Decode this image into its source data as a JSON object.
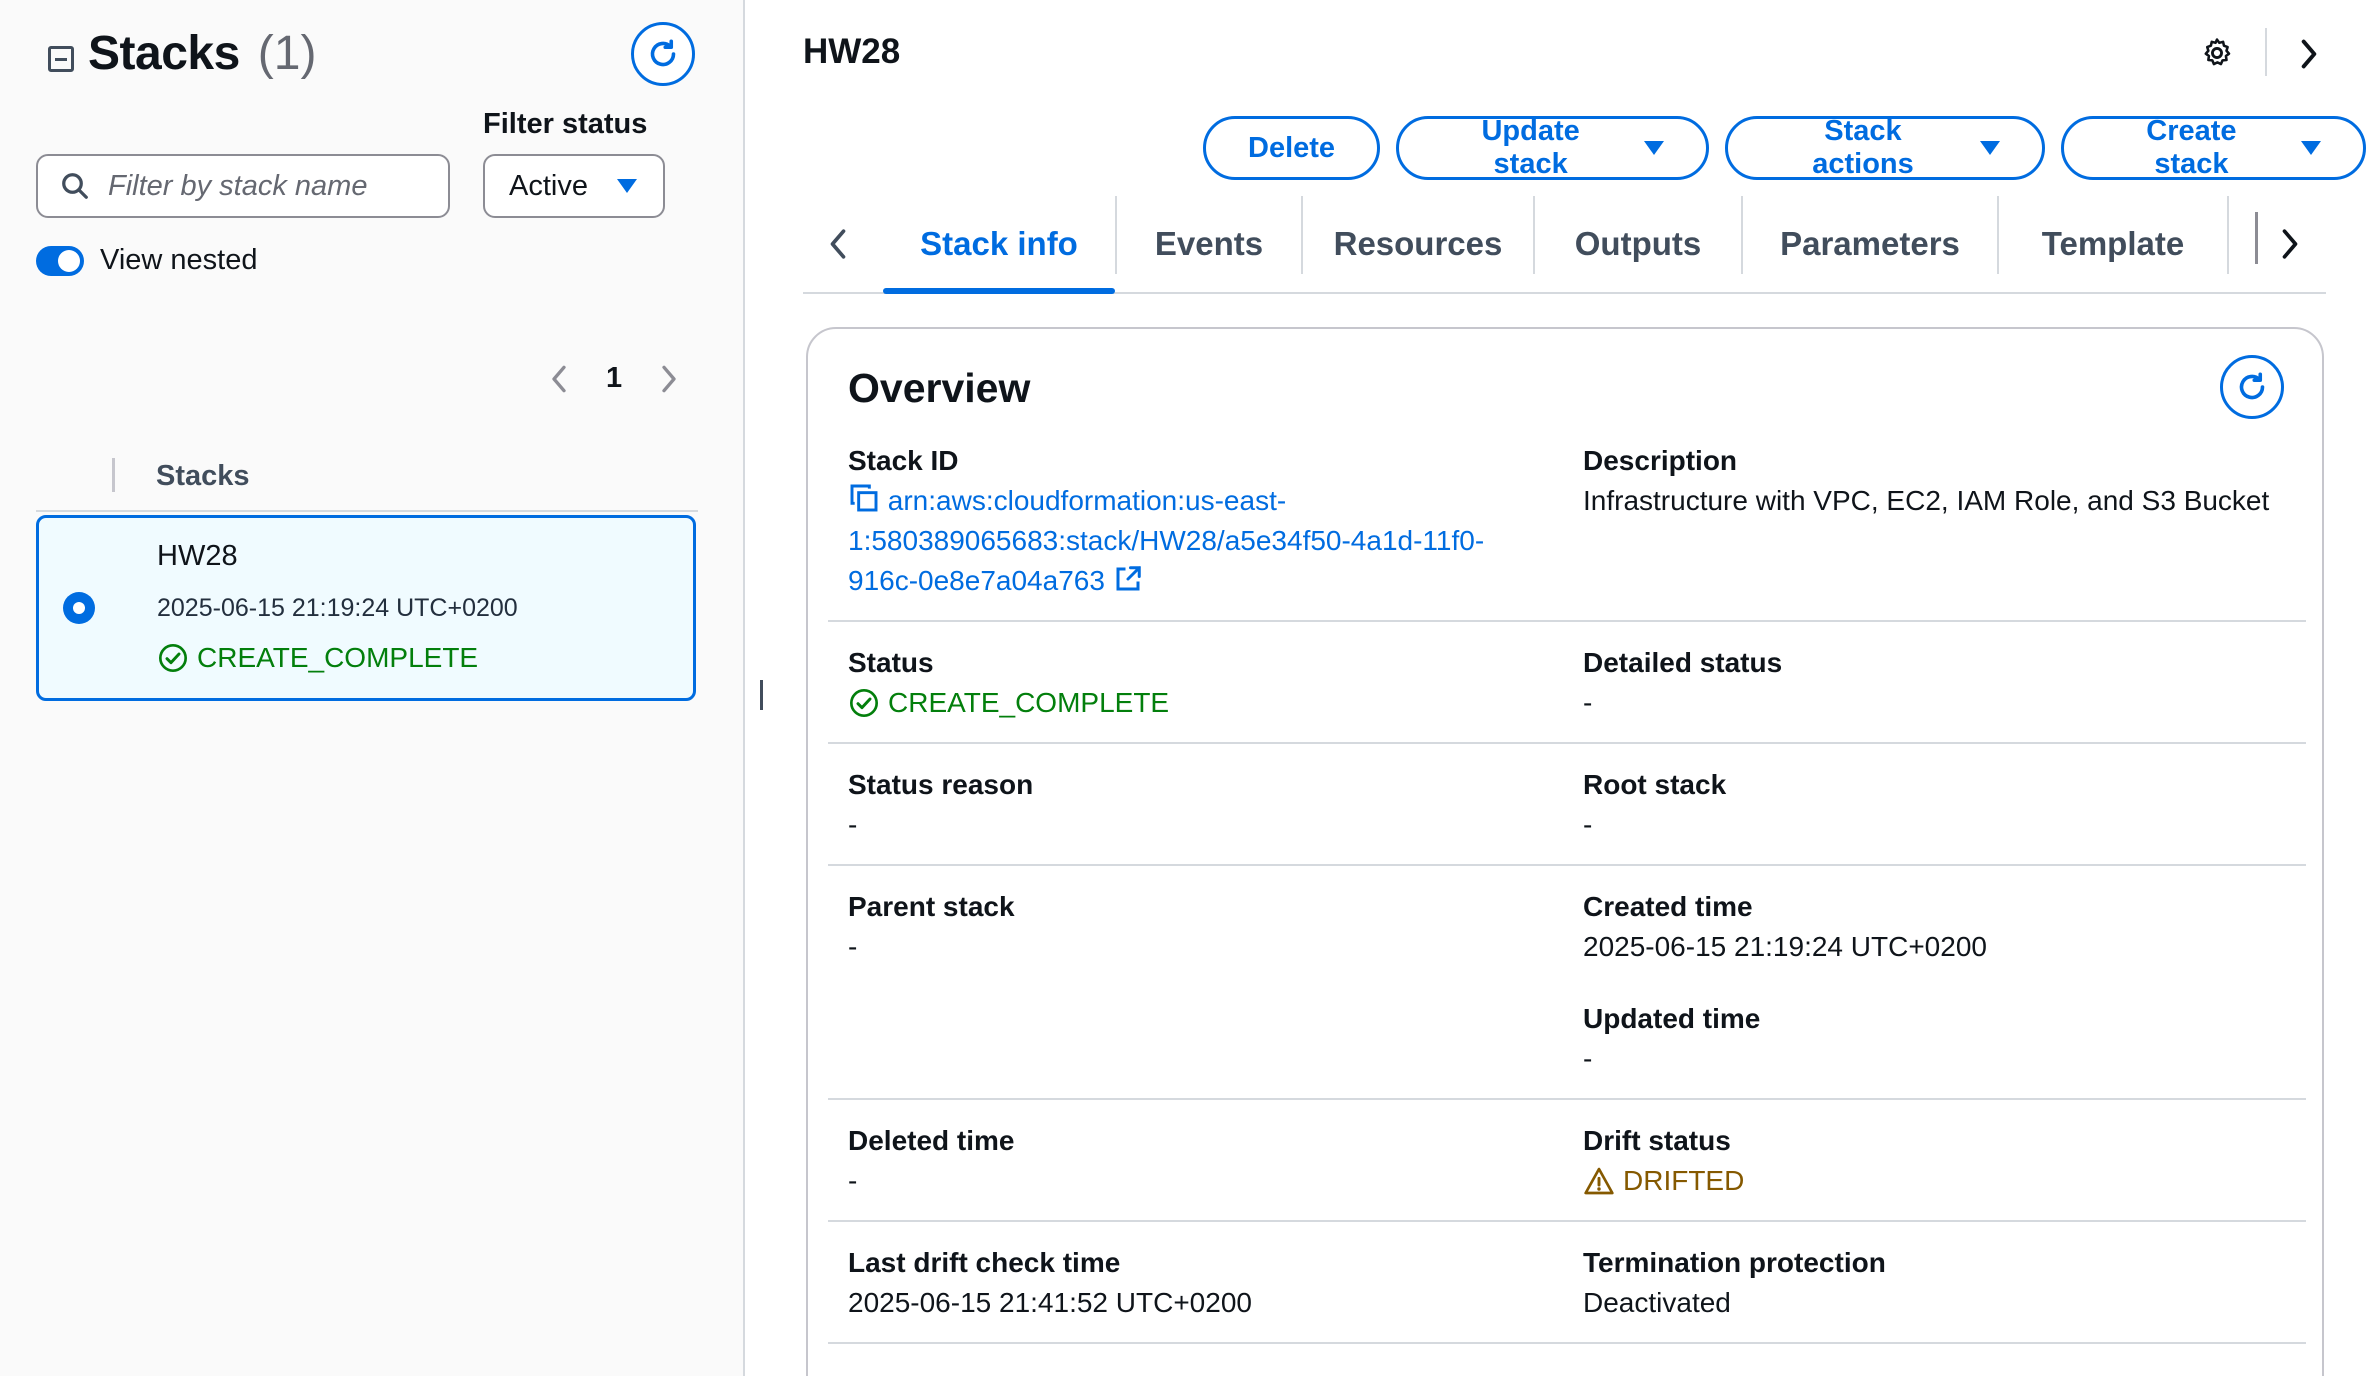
{
  "left_panel": {
    "title": "Stacks",
    "count": "(1)",
    "search_placeholder": "Filter by stack name",
    "filter_label": "Filter status",
    "filter_value": "Active",
    "view_nested_label": "View nested",
    "page_number": "1",
    "column_header": "Stacks",
    "stack": {
      "name": "HW28",
      "timestamp": "2025-06-15 21:19:24 UTC+0200",
      "status": "CREATE_COMPLETE"
    }
  },
  "header": {
    "stack_name": "HW28"
  },
  "actions": {
    "delete": "Delete",
    "update_stack": "Update stack",
    "stack_actions": "Stack actions",
    "create_stack": "Create stack"
  },
  "tabs": [
    "Stack info",
    "Events",
    "Resources",
    "Outputs",
    "Parameters",
    "Template"
  ],
  "overview": {
    "title": "Overview",
    "stack_id_label": "Stack ID",
    "stack_id": "arn:aws:cloudformation:us-east-1:580389065683:stack/HW28/a5e34f50-4a1d-11f0-916c-0e8e7a04a763",
    "stack_id_lines": [
      "arn:aws:cloudformation:us-east-",
      "1:580389065683:stack/HW28/a5e34f50-4a1d-11f0-",
      "916c-0e8e7a04a763"
    ],
    "description_label": "Description",
    "description": "Infrastructure with VPC, EC2, IAM Role, and S3 Bucket",
    "status_label": "Status",
    "status": "CREATE_COMPLETE",
    "detailed_status_label": "Detailed status",
    "detailed_status": "-",
    "status_reason_label": "Status reason",
    "status_reason": "-",
    "root_stack_label": "Root stack",
    "root_stack": "-",
    "parent_stack_label": "Parent stack",
    "parent_stack": "-",
    "created_time_label": "Created time",
    "created_time": "2025-06-15 21:19:24 UTC+0200",
    "updated_time_label": "Updated time",
    "updated_time": "-",
    "deleted_time_label": "Deleted time",
    "deleted_time": "-",
    "drift_status_label": "Drift status",
    "drift_status": "DRIFTED",
    "last_drift_check_label": "Last drift check time",
    "last_drift_check": "2025-06-15 21:41:52 UTC+0200",
    "termination_protection_label": "Termination protection",
    "termination_protection": "Deactivated"
  },
  "colors": {
    "accent": "#006ce0",
    "success": "#037f0c",
    "warning": "#855900",
    "border": "#d5d9de"
  },
  "icons": [
    "collapse-icon",
    "refresh-icon",
    "search-icon",
    "caret-down-icon",
    "chevron-left-icon",
    "chevron-right-icon",
    "success-icon",
    "gear-icon",
    "copy-icon",
    "external-link-icon",
    "warning-icon"
  ]
}
